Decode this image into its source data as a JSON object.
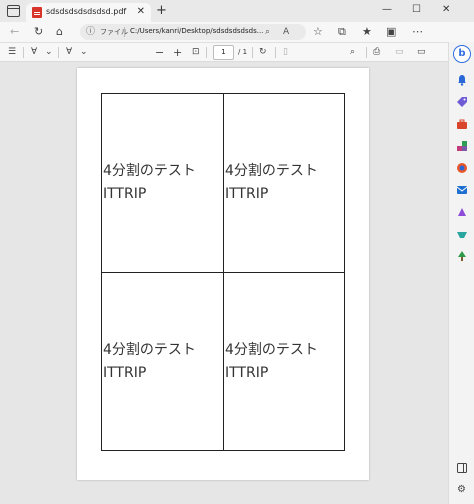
{
  "tab": {
    "title": "sdsdsdsdsdsdsd.pdf",
    "close": "✕"
  },
  "new_tab": "+",
  "window_controls": {
    "minimize": "—",
    "maximize": "☐",
    "close": "✕"
  },
  "nav": {
    "back": "←",
    "refresh": "↻",
    "home": "⌂"
  },
  "address": {
    "info_icon": "ⓘ",
    "label": "ファイル",
    "url": "C:/Users/kanri/Desktop/sdsdsdsdsds..."
  },
  "address_icons": {
    "zoom": "⌕",
    "read_aloud": "A",
    "favorite": "☆",
    "split": "⧉",
    "favorites": "★",
    "collections": "▣",
    "more": "⋯"
  },
  "pdf_toolbar": {
    "contents": "☰",
    "highlight": "∀",
    "highlight_dd": "⌄",
    "draw": "∀",
    "draw_dd": "⌄",
    "zoom_out": "−",
    "zoom_in": "+",
    "fit": "⊡",
    "page_current": "1",
    "page_total": "/ 1",
    "rotate": "↻",
    "two_page": "▯",
    "search": "⌕",
    "print": "⎙",
    "save": "▭",
    "save_as": "▭"
  },
  "sidebar": {
    "bing": "b",
    "add": "+",
    "settings": "⚙"
  },
  "document": {
    "cells": [
      {
        "line1": "4分割のテスト",
        "line2": "ITTRIP"
      },
      {
        "line1": "4分割のテスト",
        "line2": "ITTRIP"
      },
      {
        "line1": "4分割のテスト",
        "line2": "ITTRIP"
      },
      {
        "line1": "4分割のテスト",
        "line2": "ITTRIP"
      }
    ]
  }
}
